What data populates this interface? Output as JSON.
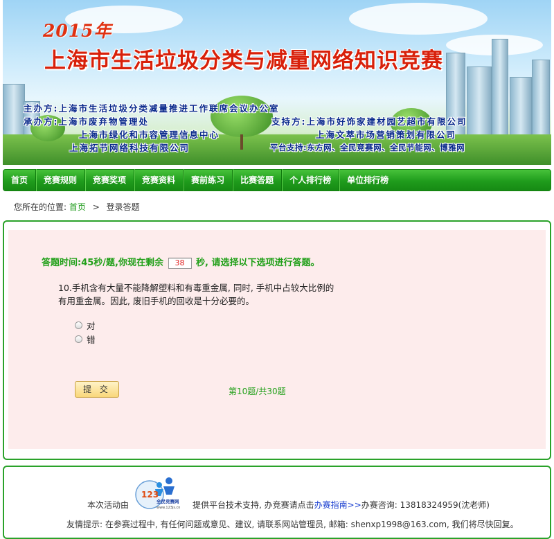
{
  "banner": {
    "year": "2015年",
    "title": "上海市生活垃圾分类与减量网络知识竞赛",
    "organizer": "主办方:上海市生活垃圾分类减量推进工作联席会议办公室",
    "co_organizer_1": "承办方:上海市废弃物管理处",
    "co_organizer_2": "上海市绿化和市容管理信息中心",
    "co_organizer_3": "上海拓节网络科技有限公司",
    "support_1": "支持方:上海市好饰家建材园艺超市有限公司",
    "support_2": "上海文萃市场营销策划有限公司",
    "platform": "平台支持:东方网、全民竞赛网、全民节能网、博雅网"
  },
  "nav": {
    "items": [
      "首页",
      "竞赛规则",
      "竞赛奖项",
      "竞赛资料",
      "赛前练习",
      "比赛答题",
      "个人排行榜",
      "单位排行榜"
    ]
  },
  "breadcrumb": {
    "prefix": "您所在的位置:",
    "home": "首页",
    "separator": ">",
    "current": "登录答题"
  },
  "quiz": {
    "timer_prefix": "答题时间:45秒/题,你现在剩余",
    "remaining": "38",
    "timer_suffix": "秒, 请选择以下选项进行答题。",
    "question": "10.手机含有大量不能降解塑料和有毒重金属, 同时, 手机中占较大比例的有用重金属。因此, 废旧手机的回收是十分必要的。",
    "options": [
      "对",
      "错"
    ],
    "submit_label": "提 交",
    "progress": "第10题/共30题"
  },
  "footer": {
    "activity_by": "本次活动由",
    "logo_text": "全民竞赛网",
    "logo_url": "www.123js.cn",
    "support_text_1": "提供平台技术支持, 办竞赛请点击",
    "guide_link": "办赛指南>>",
    "support_text_2": "办赛咨询: 13818324959(沈老师)",
    "tip": "友情提示: 在参赛过程中, 有任何问题或意见、建议, 请联系网站管理员, 邮箱: shenxp1998@163.com, 我们将尽快回复。"
  },
  "colors": {
    "nav_green": "#1f9c1c",
    "panel_pink": "#fdecec",
    "accent_green": "#22a01a",
    "title_red": "#d8200a",
    "org_blue": "#0a2a8c"
  }
}
